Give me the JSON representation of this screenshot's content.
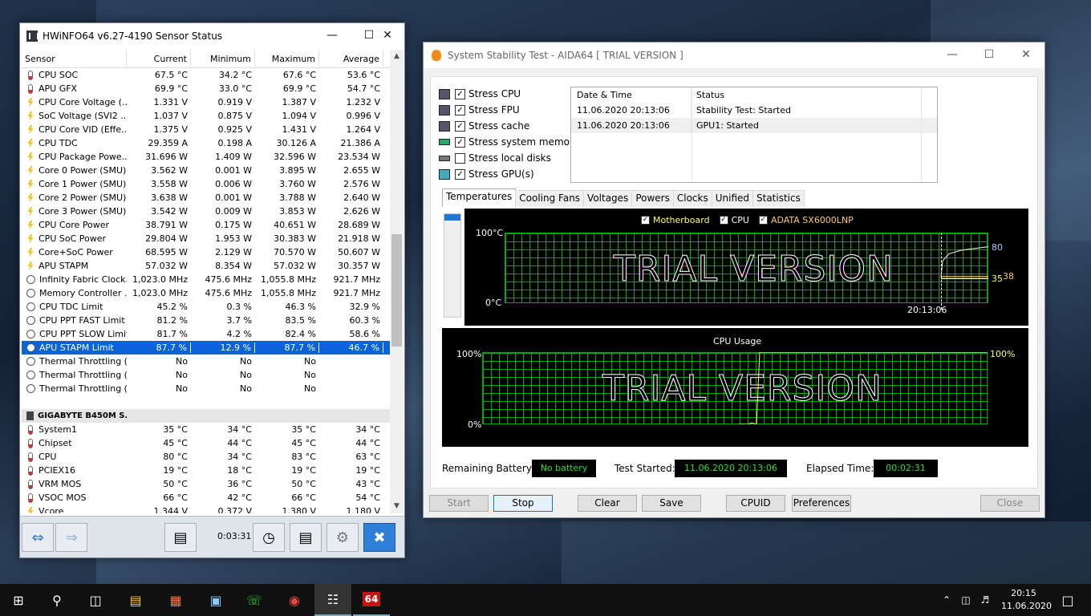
{
  "hwinfo": {
    "title": "HWiNFO64 v6.27-4190 Sensor Status",
    "columns": [
      "Sensor",
      "Current",
      "Minimum",
      "Maximum",
      "Average"
    ],
    "rows": [
      {
        "icon": "temp",
        "name": "CPU SOC",
        "cur": "67.5 °C",
        "min": "34.2 °C",
        "max": "67.6 °C",
        "avg": "53.6 °C"
      },
      {
        "icon": "temp",
        "name": "APU GFX",
        "cur": "69.9 °C",
        "min": "33.0 °C",
        "max": "69.9 °C",
        "avg": "54.7 °C"
      },
      {
        "icon": "volt",
        "name": "CPU Core Voltage (...",
        "cur": "1.331 V",
        "min": "0.919 V",
        "max": "1.387 V",
        "avg": "1.232 V"
      },
      {
        "icon": "volt",
        "name": "SoC Voltage (SVI2 ...",
        "cur": "1.037 V",
        "min": "0.875 V",
        "max": "1.094 V",
        "avg": "0.996 V"
      },
      {
        "icon": "volt",
        "name": "CPU Core VID (Effe...",
        "cur": "1.375 V",
        "min": "0.925 V",
        "max": "1.431 V",
        "avg": "1.264 V"
      },
      {
        "icon": "volt",
        "name": "CPU TDC",
        "cur": "29.359 A",
        "min": "0.198 A",
        "max": "30.126 A",
        "avg": "21.386 A"
      },
      {
        "icon": "power",
        "name": "CPU Package Powe...",
        "cur": "31.696 W",
        "min": "1.409 W",
        "max": "32.596 W",
        "avg": "23.534 W"
      },
      {
        "icon": "power",
        "name": "Core 0 Power (SMU)",
        "cur": "3.562 W",
        "min": "0.001 W",
        "max": "3.895 W",
        "avg": "2.655 W"
      },
      {
        "icon": "power",
        "name": "Core 1 Power (SMU)",
        "cur": "3.558 W",
        "min": "0.006 W",
        "max": "3.760 W",
        "avg": "2.576 W"
      },
      {
        "icon": "power",
        "name": "Core 2 Power (SMU)",
        "cur": "3.638 W",
        "min": "0.001 W",
        "max": "3.788 W",
        "avg": "2.640 W"
      },
      {
        "icon": "power",
        "name": "Core 3 Power (SMU)",
        "cur": "3.542 W",
        "min": "0.009 W",
        "max": "3.853 W",
        "avg": "2.626 W"
      },
      {
        "icon": "power",
        "name": "CPU Core Power",
        "cur": "38.791 W",
        "min": "0.175 W",
        "max": "40.651 W",
        "avg": "28.689 W"
      },
      {
        "icon": "power",
        "name": "CPU SoC Power",
        "cur": "29.804 W",
        "min": "1.953 W",
        "max": "30.383 W",
        "avg": "21.918 W"
      },
      {
        "icon": "power",
        "name": "Core+SoC Power",
        "cur": "68.595 W",
        "min": "2.129 W",
        "max": "70.570 W",
        "avg": "50.607 W"
      },
      {
        "icon": "power",
        "name": "APU STAPM",
        "cur": "57.032 W",
        "min": "8.354 W",
        "max": "57.032 W",
        "avg": "30.357 W"
      },
      {
        "icon": "clock",
        "name": "Infinity Fabric Clock...",
        "cur": "1,023.0 MHz",
        "min": "475.6 MHz",
        "max": "1,055.8 MHz",
        "avg": "921.7 MHz"
      },
      {
        "icon": "clock",
        "name": "Memory Controller ...",
        "cur": "1,023.0 MHz",
        "min": "475.6 MHz",
        "max": "1,055.8 MHz",
        "avg": "921.7 MHz"
      },
      {
        "icon": "clock",
        "name": "CPU TDC Limit",
        "cur": "45.2 %",
        "min": "0.3 %",
        "max": "46.3 %",
        "avg": "32.9 %"
      },
      {
        "icon": "clock",
        "name": "CPU PPT FAST Limit",
        "cur": "81.2 %",
        "min": "3.7 %",
        "max": "83.5 %",
        "avg": "60.3 %"
      },
      {
        "icon": "clock",
        "name": "CPU PPT SLOW Limit",
        "cur": "81.7 %",
        "min": "4.2 %",
        "max": "82.4 %",
        "avg": "58.6 %"
      },
      {
        "icon": "clock",
        "name": "APU STAPM Limit",
        "cur": "87.7 %",
        "min": "12.9 %",
        "max": "87.7 %",
        "avg": "46.7 %",
        "selected": true
      },
      {
        "icon": "clock",
        "name": "Thermal Throttling (...",
        "cur": "No",
        "min": "No",
        "max": "No",
        "avg": ""
      },
      {
        "icon": "clock",
        "name": "Thermal Throttling (...",
        "cur": "No",
        "min": "No",
        "max": "No",
        "avg": ""
      },
      {
        "icon": "clock",
        "name": "Thermal Throttling (...",
        "cur": "No",
        "min": "No",
        "max": "No",
        "avg": ""
      },
      {
        "blank": true
      },
      {
        "group": true,
        "icon": "chip",
        "name": "GIGABYTE B450M S..."
      },
      {
        "icon": "temp",
        "name": "System1",
        "cur": "35 °C",
        "min": "34 °C",
        "max": "35 °C",
        "avg": "34 °C"
      },
      {
        "icon": "temp",
        "name": "Chipset",
        "cur": "45 °C",
        "min": "44 °C",
        "max": "45 °C",
        "avg": "44 °C"
      },
      {
        "icon": "temp",
        "name": "CPU",
        "cur": "80 °C",
        "min": "34 °C",
        "max": "83 °C",
        "avg": "63 °C"
      },
      {
        "icon": "temp",
        "name": "PCIEX16",
        "cur": "19 °C",
        "min": "18 °C",
        "max": "19 °C",
        "avg": "19 °C"
      },
      {
        "icon": "temp",
        "name": "VRM MOS",
        "cur": "50 °C",
        "min": "36 °C",
        "max": "50 °C",
        "avg": "43 °C"
      },
      {
        "icon": "temp",
        "name": "VSOC MOS",
        "cur": "66 °C",
        "min": "42 °C",
        "max": "66 °C",
        "avg": "54 °C"
      },
      {
        "icon": "volt",
        "name": "Vcore",
        "cur": "1.344 V",
        "min": "0.372 V",
        "max": "1.380 V",
        "avg": "1.180 V"
      }
    ],
    "timer": "0:03:31"
  },
  "aida": {
    "title": "System Stability Test - AIDA64  [ TRIAL VERSION ]",
    "stress": [
      {
        "label": "Stress CPU",
        "checked": true
      },
      {
        "label": "Stress FPU",
        "checked": true
      },
      {
        "label": "Stress cache",
        "checked": true
      },
      {
        "label": "Stress system memory",
        "checked": true
      },
      {
        "label": "Stress local disks",
        "checked": false
      },
      {
        "label": "Stress GPU(s)",
        "checked": true
      }
    ],
    "log_headers": [
      "Date & Time",
      "Status"
    ],
    "log": [
      {
        "time": "11.06.2020 20:13:06",
        "status": "Stability Test: Started"
      },
      {
        "time": "11.06.2020 20:13:06",
        "status": "GPU1: Started"
      }
    ],
    "tabs": [
      "Temperatures",
      "Cooling Fans",
      "Voltages",
      "Powers",
      "Clocks",
      "Unified",
      "Statistics"
    ],
    "temp_graph": {
      "legend": [
        "Motherboard",
        "CPU",
        "ADATA SX6000LNP"
      ],
      "legend_colors": [
        "#ffff66",
        "#ffffff",
        "#ffcc66"
      ],
      "y_max": "100°C",
      "y_min": "0°C",
      "time": "20:13:06",
      "watermark": "TRIAL VERSION",
      "end_values": [
        "80",
        "35",
        "38"
      ]
    },
    "cpu_graph": {
      "title": "CPU Usage",
      "y_max": "100%",
      "y_min": "0%",
      "end_value": "100%",
      "watermark": "TRIAL VERSION"
    },
    "status": {
      "battery_label": "Remaining Battery:",
      "battery": "No battery",
      "started_label": "Test Started:",
      "started": "11.06.2020 20:13:06",
      "elapsed_label": "Elapsed Time:",
      "elapsed": "00:02:31"
    },
    "buttons": [
      "Start",
      "Stop",
      "Clear",
      "Save",
      "CPUID",
      "Preferences",
      "Close"
    ]
  },
  "taskbar": {
    "time": "20:15",
    "date": "11.06.2020"
  },
  "chart_data": [
    {
      "type": "line",
      "title": "",
      "ylabel": "",
      "ylim": [
        0,
        100
      ],
      "x": [
        "20:13:06"
      ],
      "series": [
        {
          "name": "Motherboard",
          "values": [
            35
          ]
        },
        {
          "name": "CPU",
          "values": [
            80
          ]
        },
        {
          "name": "ADATA SX6000LNP",
          "values": [
            38
          ]
        }
      ]
    },
    {
      "type": "line",
      "title": "CPU Usage",
      "ylim": [
        0,
        100
      ],
      "series": [
        {
          "values": [
            0,
            0,
            100,
            100,
            100
          ]
        }
      ]
    }
  ]
}
